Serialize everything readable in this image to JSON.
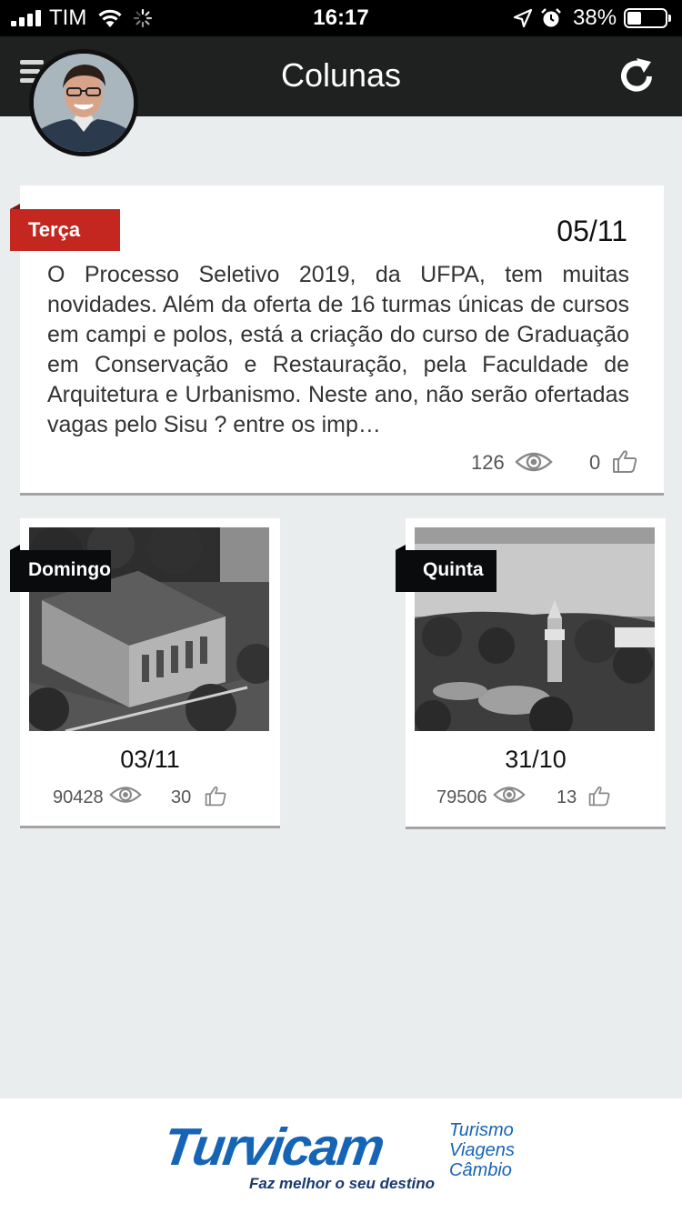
{
  "status_bar": {
    "carrier": "TIM",
    "time": "16:17",
    "battery_percent": "38%",
    "battery_level": 0.38
  },
  "header": {
    "title": "Colunas",
    "menu_icon": "hamburger-icon",
    "refresh_icon": "refresh-icon"
  },
  "featured": {
    "day": "Terça",
    "date": "05/11",
    "excerpt": "O Processo Seletivo 2019, da UFPA, tem muitas novidades. Além da oferta de 16 turmas únicas de cursos em campi e polos, está a criação do curso de Graduação em Conservação e Restauração, pela Faculdade de Arquitetura e Urbanismo. Neste ano, não serão ofertadas vagas pelo Sisu ? entre os imp…",
    "views": "126",
    "likes": "0"
  },
  "cards": [
    {
      "day": "Domingo",
      "date": "03/11",
      "views": "90428",
      "likes": "30"
    },
    {
      "day": "Quinta",
      "date": "31/10",
      "views": "79506",
      "likes": "13"
    }
  ],
  "footer": {
    "brand": "Turvicam",
    "side_line1": "Turismo",
    "side_line2": "Viagens",
    "side_line3": "Câmbio",
    "tagline": "Faz melhor o seu destino"
  },
  "colors": {
    "header_bg": "#1f2020",
    "ribbon_red": "#c4271f",
    "ribbon_dark": "#090b0c",
    "brand_blue": "#1664b6",
    "page_bg": "#eaedee"
  }
}
